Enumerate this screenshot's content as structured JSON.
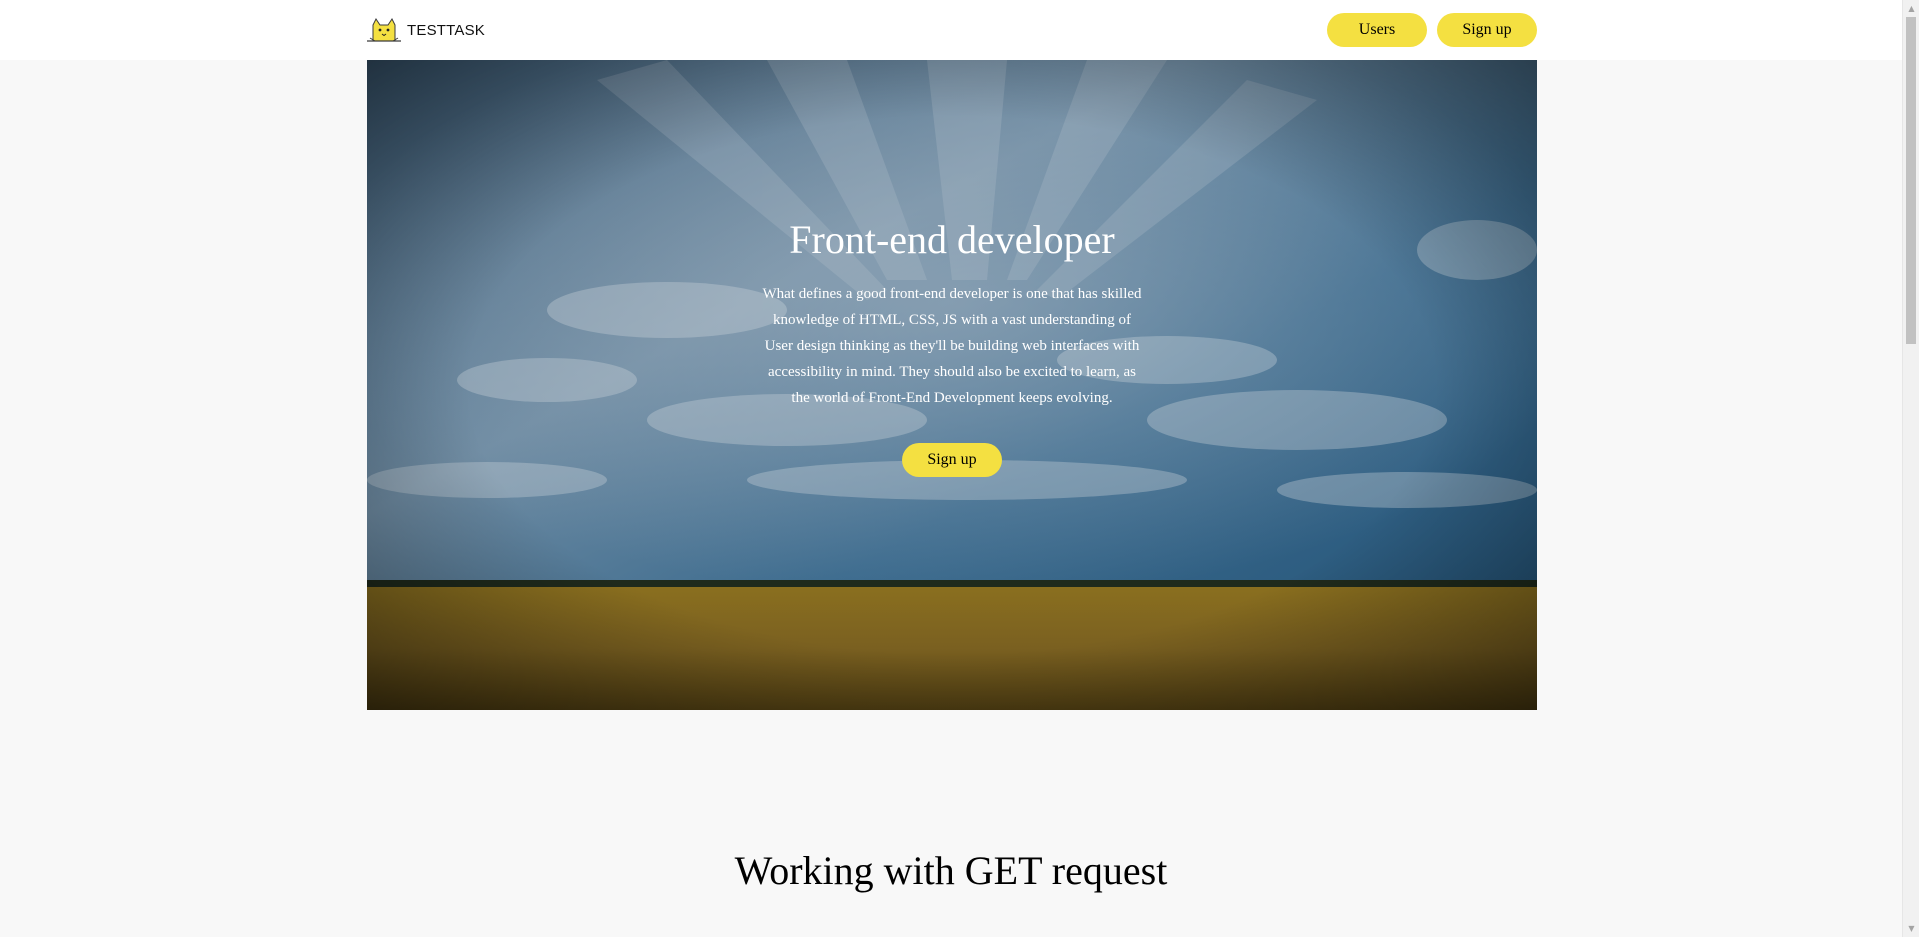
{
  "header": {
    "logo_text": "TESTTASK",
    "nav": {
      "users_label": "Users",
      "signup_label": "Sign up"
    }
  },
  "hero": {
    "title": "Front-end developer",
    "text": "What defines a good front-end developer is one that has skilled knowledge of HTML, CSS, JS with a vast understanding of User design thinking as they'll be building web interfaces with accessibility in mind. They should also be excited to learn, as the world of Front-End Development keeps evolving.",
    "button_label": "Sign up"
  },
  "sections": {
    "get_title": "Working with GET request"
  },
  "colors": {
    "accent": "#f4e041",
    "page_background": "#f8f8f8",
    "header_background": "#ffffff"
  },
  "icons": {
    "logo": "cat-logo-icon",
    "scroll_up": "arrow-up-icon",
    "scroll_down": "arrow-down-icon"
  }
}
